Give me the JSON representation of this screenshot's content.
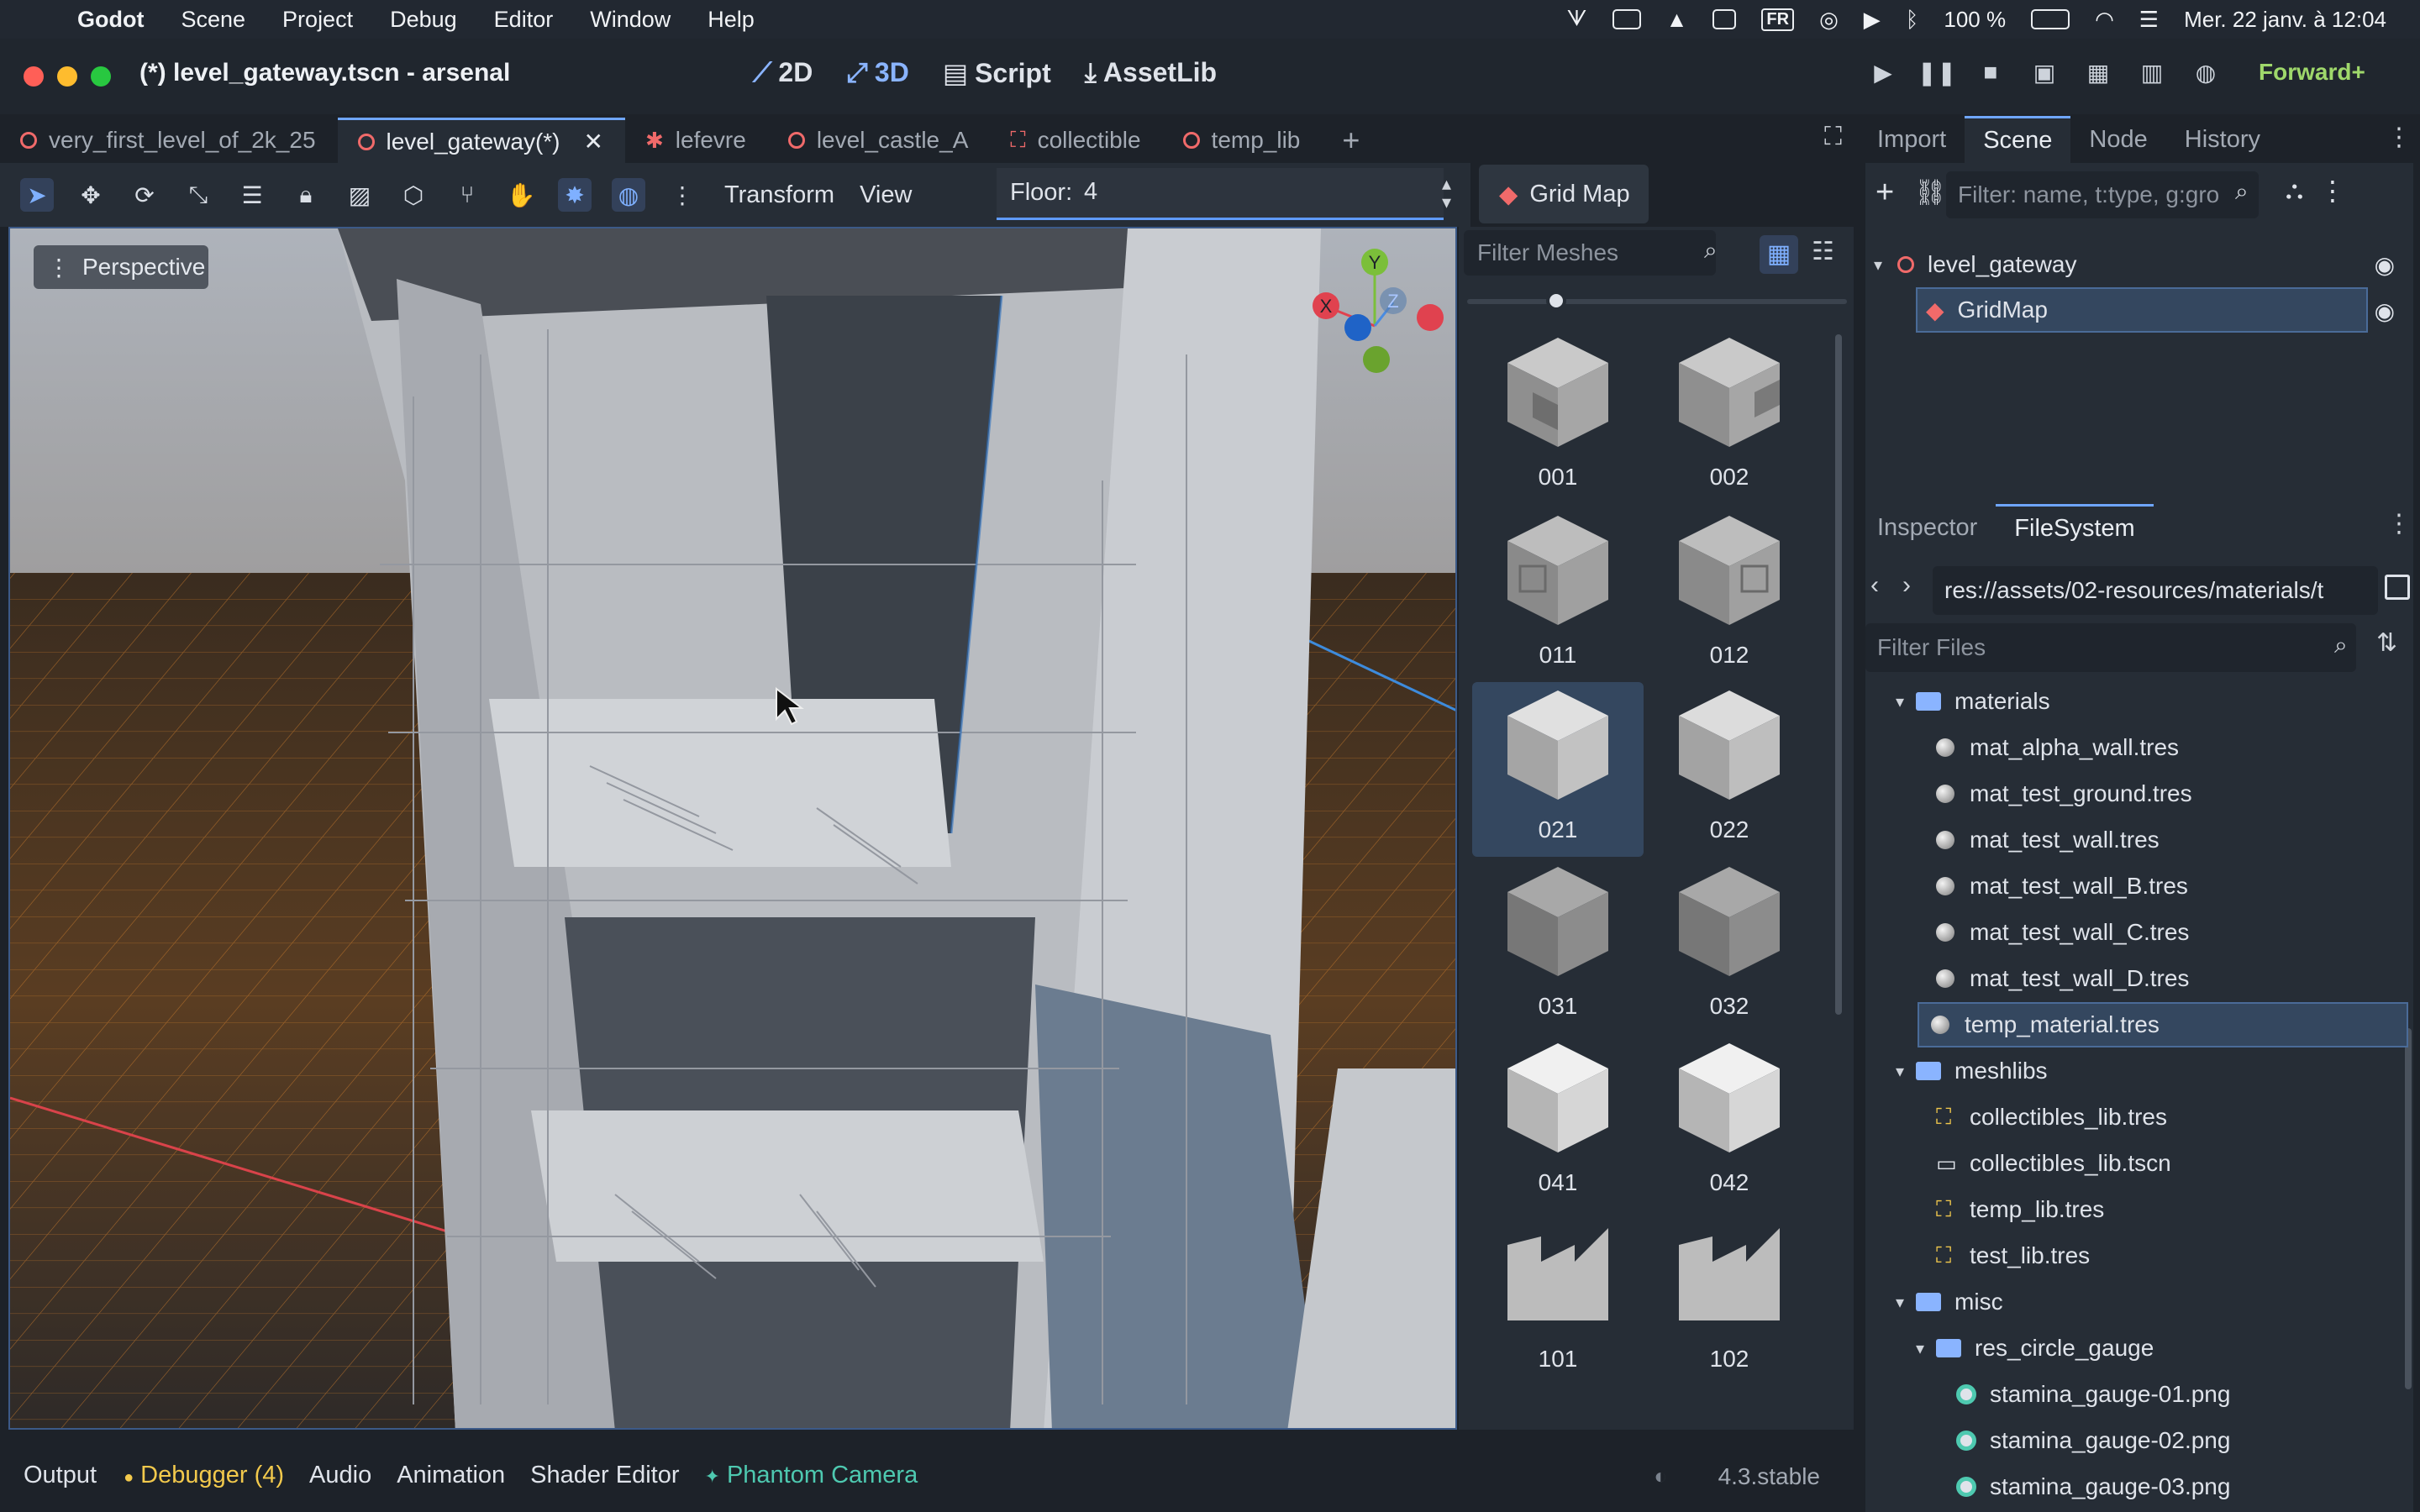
{
  "menubar": {
    "app_name": "Godot",
    "items": [
      "Scene",
      "Project",
      "Debug",
      "Editor",
      "Window",
      "Help"
    ],
    "battery": "100 %",
    "input_source": "FR",
    "datetime": "Mer. 22 janv. à  12:04"
  },
  "window": {
    "title": "(*) level_gateway.tscn - arsenal",
    "workspaces": [
      "2D",
      "3D",
      "Script",
      "AssetLib"
    ],
    "active_workspace": "3D",
    "renderer": "Forward+"
  },
  "scene_tabs": [
    {
      "label": "very_first_level_of_2k_25",
      "icon": "circle"
    },
    {
      "label": "level_gateway(*)",
      "icon": "circle",
      "active": true
    },
    {
      "label": "lefevre",
      "icon": "skeleton"
    },
    {
      "label": "level_castle_A",
      "icon": "circle"
    },
    {
      "label": "collectible",
      "icon": "scene-frame"
    },
    {
      "label": "temp_lib",
      "icon": "circle"
    }
  ],
  "toolbar": {
    "transform_label": "Transform",
    "view_label": "View",
    "floor_label": "Floor:",
    "floor_value": "4",
    "gridmap_label": "Grid Map"
  },
  "viewport": {
    "mode_label": "Perspective",
    "gizmo_axes": [
      "Y",
      "X",
      "Z"
    ]
  },
  "mesh_palette": {
    "filter_placeholder": "Filter Meshes",
    "items": [
      "001",
      "002",
      "011",
      "012",
      "021",
      "022",
      "031",
      "032",
      "041",
      "042",
      "101",
      "102"
    ],
    "selected": "021"
  },
  "scene_dock": {
    "tabs": [
      "Import",
      "Scene",
      "Node",
      "History"
    ],
    "active_tab": "Scene",
    "filter_placeholder": "Filter: name, t:type, g:gro",
    "nodes": [
      {
        "label": "level_gateway"
      },
      {
        "label": "GridMap",
        "selected": true
      }
    ]
  },
  "filesystem_dock": {
    "tabs": [
      "Inspector",
      "FileSystem"
    ],
    "active_tab": "FileSystem",
    "path": "res://assets/02-resources/materials/t",
    "filter_placeholder": "Filter Files",
    "items": [
      {
        "label": "materials",
        "type": "folder",
        "level": 0
      },
      {
        "label": "mat_alpha_wall.tres",
        "type": "material",
        "level": 1
      },
      {
        "label": "mat_test_ground.tres",
        "type": "material",
        "level": 1
      },
      {
        "label": "mat_test_wall.tres",
        "type": "material",
        "level": 1
      },
      {
        "label": "mat_test_wall_B.tres",
        "type": "material",
        "level": 1
      },
      {
        "label": "mat_test_wall_C.tres",
        "type": "material",
        "level": 1
      },
      {
        "label": "mat_test_wall_D.tres",
        "type": "material",
        "level": 1
      },
      {
        "label": "temp_material.tres",
        "type": "material",
        "level": 1,
        "selected": true
      },
      {
        "label": "meshlibs",
        "type": "folder",
        "level": 0
      },
      {
        "label": "collectibles_lib.tres",
        "type": "meshlib",
        "level": 1
      },
      {
        "label": "collectibles_lib.tscn",
        "type": "scene",
        "level": 1
      },
      {
        "label": "temp_lib.tres",
        "type": "meshlib",
        "level": 1
      },
      {
        "label": "test_lib.tres",
        "type": "meshlib",
        "level": 1
      },
      {
        "label": "misc",
        "type": "folder",
        "level": 0
      },
      {
        "label": "res_circle_gauge",
        "type": "folder",
        "level": 1
      },
      {
        "label": "stamina_gauge-01.png",
        "type": "png",
        "level": 2
      },
      {
        "label": "stamina_gauge-02.png",
        "type": "png",
        "level": 2
      },
      {
        "label": "stamina_gauge-03.png",
        "type": "png",
        "level": 2
      }
    ]
  },
  "bottom_panel": {
    "tabs": [
      "Output",
      "Debugger (4)",
      "Audio",
      "Animation",
      "Shader Editor",
      "Phantom Camera"
    ],
    "version": "4.3.stable"
  },
  "colors": {
    "accent": "#6fa6ff",
    "scene_icon": "#f06a6a",
    "renderer": "#9fd86b",
    "debugger_dot": "#f2c94c",
    "phantom_camera": "#4ec9b0"
  }
}
